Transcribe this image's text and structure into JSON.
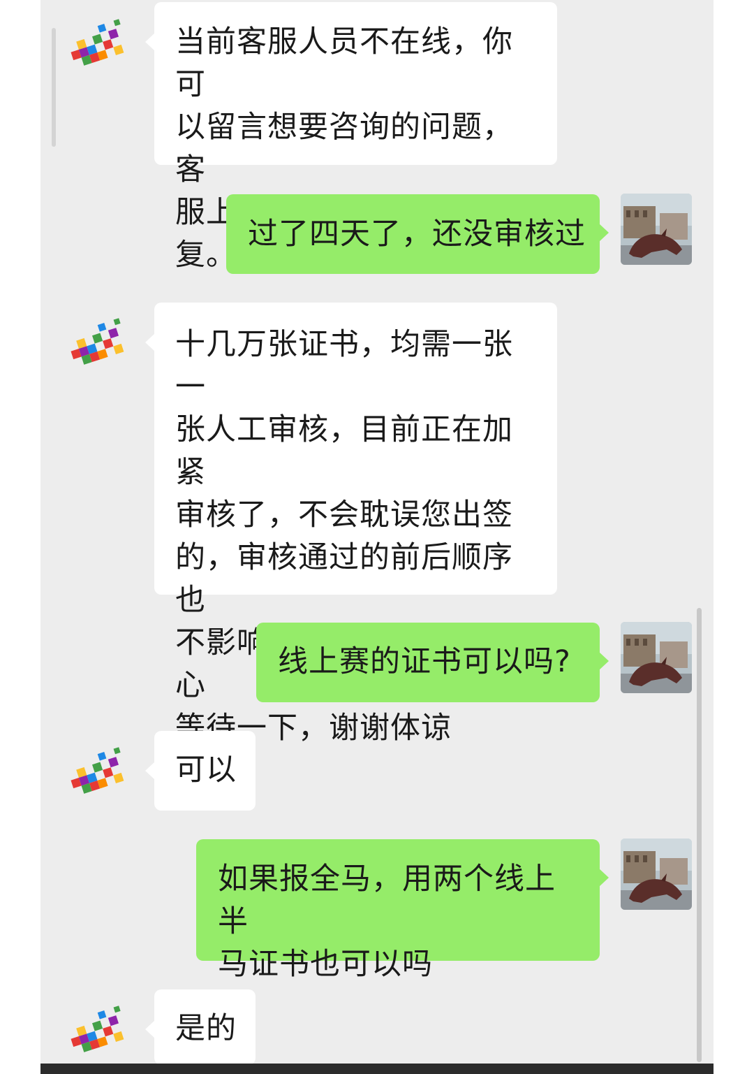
{
  "messages": [
    {
      "sender": "service",
      "text": "当前客服人员不在线，你可\n以留言想要咨询的问题，客\n服上班后将第一时间回复。"
    },
    {
      "sender": "user",
      "text": "过了四天了，还没审核过"
    },
    {
      "sender": "service",
      "text": "十几万张证书，均需一张一\n张人工审核，目前正在加紧\n审核了，不会耽误您出签\n的，审核通过的前后顺序也\n不影响您中不中签，请耐心\n等待一下，谢谢体谅"
    },
    {
      "sender": "user",
      "text": "线上赛的证书可以吗?"
    },
    {
      "sender": "service",
      "text": "可以"
    },
    {
      "sender": "user",
      "text": "如果报全马，用两个线上半\n马证书也可以吗"
    },
    {
      "sender": "service",
      "text": "是的"
    }
  ],
  "colors": {
    "chat_background": "#ededed",
    "incoming_bubble": "#ffffff",
    "outgoing_bubble": "#95ec69"
  },
  "icons": {
    "service_avatar": "colorful-logo-icon",
    "user_avatar": "bull-statue-photo-icon"
  }
}
